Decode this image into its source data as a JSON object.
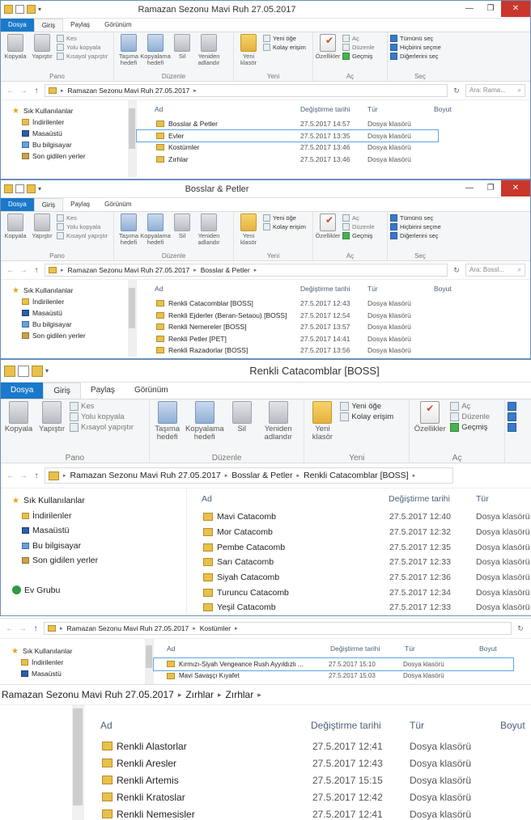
{
  "common": {
    "file_tab": "Dosya",
    "home_tab": "Giriş",
    "share_tab": "Paylaş",
    "view_tab": "Görünüm",
    "copy": "Kopyala",
    "paste": "Yapıştır",
    "cut": "Kes",
    "copy_path": "Yolu kopyala",
    "paste_shortcut": "Kısayol yapıştır",
    "move_to": "Taşıma hedefi",
    "copy_to": "Kopyalama hedefi",
    "delete": "Sil",
    "rename": "Yeniden adlandır",
    "new_folder": "Yeni klasör",
    "new_item": "Yeni öğe",
    "easy_access": "Kolay erişim",
    "properties": "Özellikler",
    "open": "Aç",
    "edit": "Düzenle",
    "history": "Geçmiş",
    "select_all": "Tümünü seç",
    "select_none": "Hiçbirini seçme",
    "invert_selection": "Diğerlerini seç",
    "group_clipboard": "Pano",
    "group_organize": "Düzenle",
    "group_new": "Yeni",
    "group_open": "Aç",
    "group_select": "Seç",
    "col_name": "Ad",
    "col_date": "Değiştirme tarihi",
    "col_type": "Tür",
    "col_size": "Boyut",
    "nav_favorites": "Sık Kullanılanlar",
    "nav_downloads": "İndirilenler",
    "nav_desktop": "Masaüstü",
    "nav_thispc": "Bu bilgisayar",
    "nav_recent": "Son gidilen yerler",
    "nav_homegroup": "Ev Grubu",
    "folder_type": "Dosya klasörü",
    "path_root": "Ramazan Sezonu Mavi Ruh 27.05.2017"
  },
  "w1": {
    "title": "Ramazan Sezonu Mavi Ruh 27.05.2017",
    "search": "Ara: Rama...",
    "rows": [
      {
        "name": "Bosslar & Petler",
        "date": "27.5.2017 14:57"
      },
      {
        "name": "Evler",
        "date": "27.5.2017 13:35"
      },
      {
        "name": "Kostümler",
        "date": "27.5.2017 13:46"
      },
      {
        "name": "Zırhlar",
        "date": "27.5.2017 13:46"
      }
    ]
  },
  "w2": {
    "title": "Bosslar & Petler",
    "path2": "Bosslar & Petler",
    "search": "Ara: Bossl...",
    "rows": [
      {
        "name": "Renkli Catacomblar [BOSS]",
        "date": "27.5.2017 12:43"
      },
      {
        "name": "Renkli Ejderler (Beran-Setaou) [BOSS]",
        "date": "27.5.2017 12:54"
      },
      {
        "name": "Renkli Nemereler [BOSS]",
        "date": "27.5.2017 13:57"
      },
      {
        "name": "Renkli Petler [PET]",
        "date": "27.5.2017 14:41"
      },
      {
        "name": "Renkli Razadorlar [BOSS]",
        "date": "27.5.2017 13:56"
      }
    ]
  },
  "w3": {
    "title": "Renkli Catacomblar [BOSS]",
    "path2": "Bosslar & Petler",
    "path3": "Renkli Catacomblar [BOSS]",
    "rows": [
      {
        "name": "Mavi Catacomb",
        "date": "27.5.2017 12:40"
      },
      {
        "name": "Mor Catacomb",
        "date": "27.5.2017 12:32"
      },
      {
        "name": "Pembe Catacomb",
        "date": "27.5.2017 12:35"
      },
      {
        "name": "Sarı Catacomb",
        "date": "27.5.2017 12:33"
      },
      {
        "name": "Siyah Catacomb",
        "date": "27.5.2017 12:36"
      },
      {
        "name": "Turuncu Catacomb",
        "date": "27.5.2017 12:34"
      },
      {
        "name": "Yeşil Catacomb",
        "date": "27.5.2017 12:33"
      }
    ]
  },
  "w4": {
    "path2": "Kostümler",
    "rows": [
      {
        "name": "Kırmızı-Siyah Vengeance Rush Ayyıldızlı ...",
        "date": "27.5.2017 15:10"
      },
      {
        "name": "Mavi Savaşçı Kıyafet",
        "date": "27.5.2017 15:03"
      }
    ]
  },
  "w5": {
    "path2": "Zırhlar",
    "path3": "Zırhlar",
    "rows": [
      {
        "name": "Renkli Alastorlar",
        "date": "27.5.2017 12:41"
      },
      {
        "name": "Renkli Aresler",
        "date": "27.5.2017 12:43"
      },
      {
        "name": "Renkli Artemis",
        "date": "27.5.2017 15:15"
      },
      {
        "name": "Renkli Kratoslar",
        "date": "27.5.2017 12:42"
      },
      {
        "name": "Renkli Nemesisler",
        "date": "27.5.2017 12:41"
      }
    ]
  }
}
